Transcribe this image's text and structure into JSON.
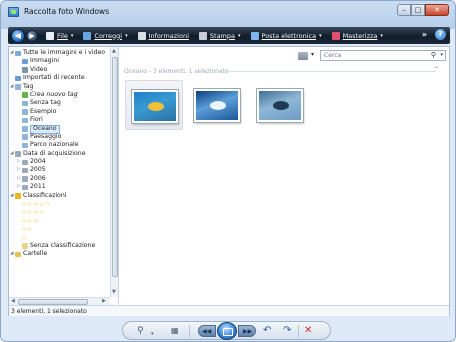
{
  "window": {
    "title": "Raccolta foto Windows",
    "controls": {
      "minimize": "–",
      "maximize": "□",
      "close": "✕"
    }
  },
  "toolbar": {
    "back": "◀",
    "forward": "▶",
    "menu": [
      {
        "label": "File",
        "icon": "file-icon",
        "color": "#e9eef5"
      },
      {
        "label": "Correggi",
        "icon": "fix-icon",
        "color": "#6aa6e0"
      },
      {
        "label": "Informazioni",
        "icon": "info-icon",
        "color": "#d9dee5"
      },
      {
        "label": "Stampa",
        "icon": "print-icon",
        "color": "#c7ced8"
      },
      {
        "label": "Posta elettronica",
        "icon": "email-icon",
        "color": "#7fb7ee"
      },
      {
        "label": "Masterizza",
        "icon": "burn-icon",
        "color": "#e2506d"
      }
    ],
    "more": "»",
    "help": "?"
  },
  "nav": {
    "tree": [
      {
        "label": "Tutte le immagini e i video",
        "level": 0,
        "expander": "◢",
        "icon": "all-images-icon",
        "iconColor": "#7ea9d6"
      },
      {
        "label": "Immagini",
        "level": 1,
        "icon": "images-icon",
        "iconColor": "#6a9cd3"
      },
      {
        "label": "Video",
        "level": 1,
        "icon": "video-icon",
        "iconColor": "#7d93b0"
      },
      {
        "label": "Importati di recente",
        "level": 0,
        "icon": "recent-import-icon",
        "iconColor": "#6a9cd3"
      },
      {
        "label": "Tag",
        "level": 0,
        "expander": "◢",
        "icon": "tag-icon",
        "iconColor": "#8fb4dc"
      },
      {
        "label": "Crea nuovo tag",
        "level": 1,
        "icon": "new-tag-icon",
        "iconColor": "#63b34a",
        "italic": true
      },
      {
        "label": "Senza tag",
        "level": 1,
        "icon": "tag-icon",
        "iconColor": "#8fb4dc"
      },
      {
        "label": "Esempio",
        "level": 1,
        "icon": "tag-icon",
        "iconColor": "#8fb4dc"
      },
      {
        "label": "Fiori",
        "level": 1,
        "icon": "tag-icon",
        "iconColor": "#8fb4dc"
      },
      {
        "label": "Oceano",
        "level": 1,
        "icon": "tag-icon",
        "iconColor": "#8fb4dc",
        "selected": true
      },
      {
        "label": "Paesaggio",
        "level": 1,
        "icon": "tag-icon",
        "iconColor": "#8fb4dc"
      },
      {
        "label": "Parco nazionale",
        "level": 1,
        "icon": "tag-icon",
        "iconColor": "#8fb4dc"
      },
      {
        "label": "Data di acquisizione",
        "level": 0,
        "expander": "◢",
        "icon": "calendar-icon",
        "iconColor": "#9aa9bb"
      },
      {
        "label": "2004",
        "level": 1,
        "expander": "▷",
        "icon": "calendar-icon",
        "iconColor": "#9aa9bb"
      },
      {
        "label": "2005",
        "level": 1,
        "expander": "▷",
        "icon": "calendar-icon",
        "iconColor": "#9aa9bb"
      },
      {
        "label": "2006",
        "level": 1,
        "expander": "▷",
        "icon": "calendar-icon",
        "iconColor": "#9aa9bb"
      },
      {
        "label": "2011",
        "level": 1,
        "expander": "▷",
        "icon": "calendar-icon",
        "iconColor": "#9aa9bb"
      },
      {
        "label": "Classificazioni",
        "level": 0,
        "expander": "◢",
        "icon": "rating-icon",
        "iconColor": "#e8b820"
      },
      {
        "label": "☆☆☆☆☆",
        "level": 1,
        "stars": true
      },
      {
        "label": "☆☆☆☆",
        "level": 1,
        "stars": true
      },
      {
        "label": "☆☆☆",
        "level": 1,
        "stars": true
      },
      {
        "label": "☆☆",
        "level": 1,
        "stars": true
      },
      {
        "label": "☆",
        "level": 1,
        "stars": true
      },
      {
        "label": "Senza classificazione",
        "level": 1,
        "icon": "unrated-icon",
        "iconColor": "#e8d78a"
      },
      {
        "label": "Cartelle",
        "level": 0,
        "expander": "◢",
        "icon": "folder-icon",
        "iconColor": "#e6c15a"
      }
    ]
  },
  "gallery": {
    "search_placeholder": "Cerca",
    "group_header": "Oceano - 3 elementi, 1 selezionato",
    "photos": [
      {
        "name": "sea-turtle",
        "selected": true,
        "colors": [
          "#1f7fc6",
          "#3a9bd3",
          "#f2c038",
          "#2a6fa0"
        ]
      },
      {
        "name": "iceberg",
        "selected": false,
        "colors": [
          "#0d3f7e",
          "#5b9fd8",
          "#eaf4fb",
          "#1a5799"
        ]
      },
      {
        "name": "whale-tail",
        "selected": false,
        "colors": [
          "#3f6f96",
          "#8fb6d6",
          "#1f3a55",
          "#6d9cc2"
        ]
      }
    ]
  },
  "status": {
    "text": "3 elementi, 1 selezionato"
  },
  "controls": {
    "zoom": "⚲",
    "fit": "▦",
    "prev": "◀◀",
    "next": "▶▶",
    "rotate_left": "↶",
    "rotate_right": "↷",
    "delete": "✕"
  }
}
